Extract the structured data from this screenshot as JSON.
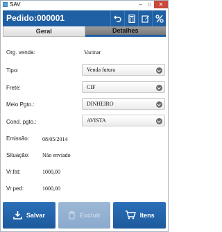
{
  "window": {
    "title": "SAV"
  },
  "header": {
    "order_title": "Pedido:000001"
  },
  "icons": {
    "undo": "undo-icon",
    "calculator": "calculator-icon",
    "edit": "edit-icon",
    "percent": "percent-icon"
  },
  "tabs": [
    {
      "label": "Geral"
    },
    {
      "label": "Detalhes"
    }
  ],
  "form": {
    "org_venda": {
      "label": "Org. venda:",
      "value": "Vacinar"
    },
    "tipo": {
      "label": "Tipo:",
      "value": "Venda futura"
    },
    "frete": {
      "label": "Frete:",
      "value": "CIF"
    },
    "meio_pgto": {
      "label": "Meio Pgto.:",
      "value": "DINHEIRO"
    },
    "cond_pgto": {
      "label": "Cond. pgto.:",
      "value": "AVISTA"
    },
    "emissao": {
      "label": "Emissão:",
      "value": "08/05/2014"
    },
    "situacao": {
      "label": "Situação:",
      "value": "Não enviado"
    },
    "vr_fat": {
      "label": "Vr.fat:",
      "value": "1000,00"
    },
    "vr_ped": {
      "label": "Vr.ped:",
      "value": "1000,00"
    }
  },
  "footer": {
    "save_label": "Salvar",
    "middle_label": "Excluir",
    "items_label": "Itens"
  },
  "colors": {
    "accent": "#1f5fa3",
    "button": "#2a6fb8"
  }
}
